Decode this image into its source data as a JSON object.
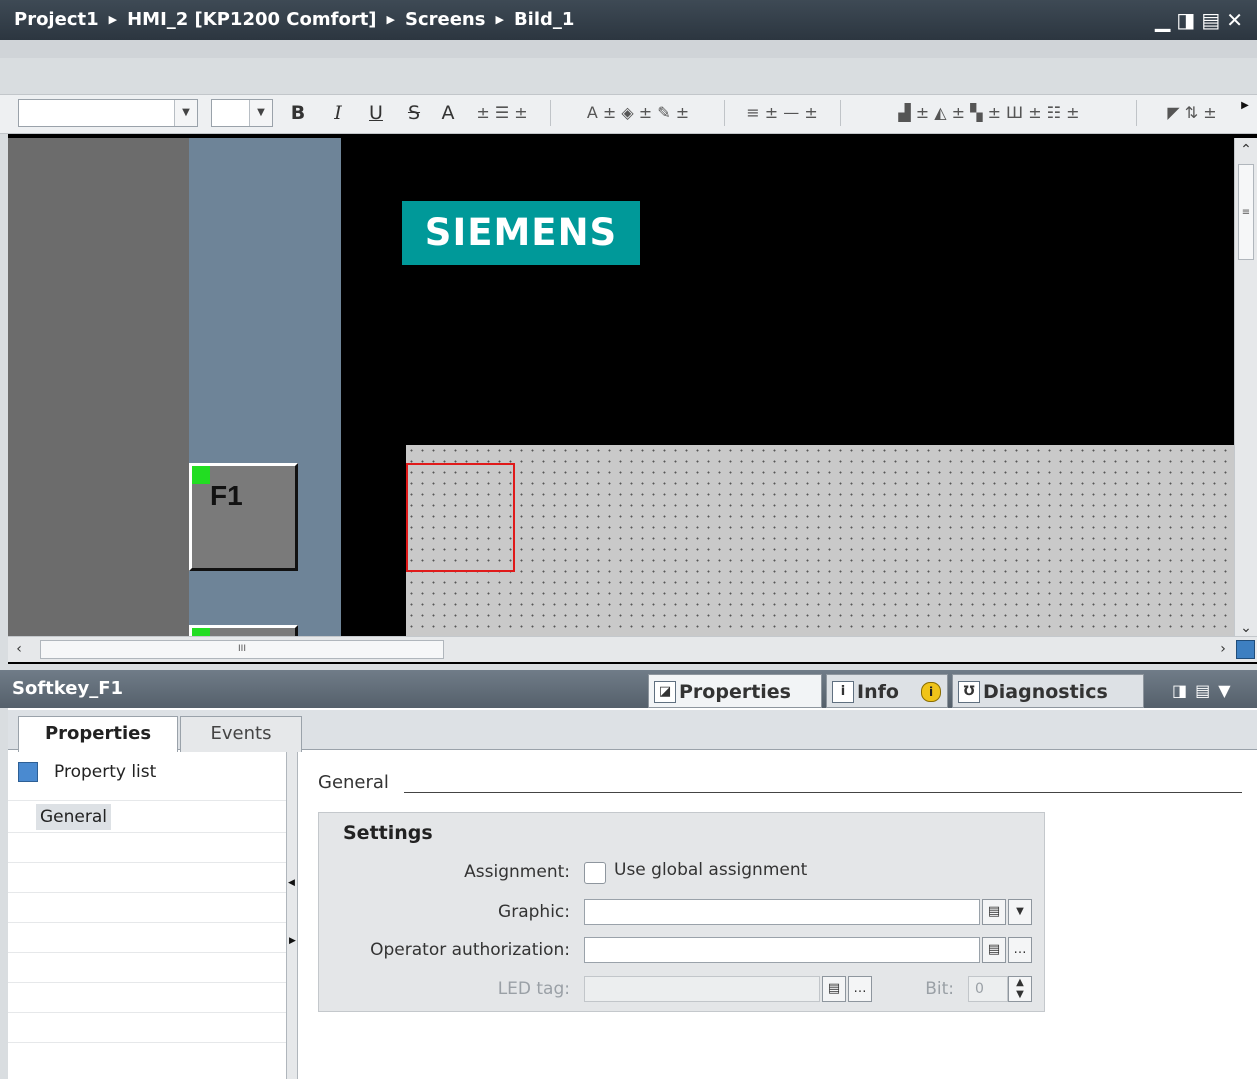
{
  "titlebar": {
    "crumbs": [
      "Project1",
      "HMI_2 [KP1200 Comfort]",
      "Screens",
      "Bild_1"
    ],
    "controls": "_ ▪ ≡ ✕"
  },
  "toolbar": {
    "bold": "B",
    "italic": "I",
    "underline": "U",
    "strike": "S",
    "font_size_up": "A"
  },
  "editor": {
    "logo_text": "SIEMENS",
    "fkey1_label": "F1",
    "hscroll_grip": "III"
  },
  "inspector": {
    "object_name": "Softkey_F1",
    "tabs": [
      {
        "label": "Properties",
        "active": true
      },
      {
        "label": "Info",
        "active": false
      },
      {
        "label": "Diagnostics",
        "active": false
      }
    ],
    "subtabs": [
      "Properties",
      "Events"
    ],
    "nav": {
      "property_list_label": "Property list",
      "items": [
        "General"
      ]
    },
    "section_title": "General",
    "group_title": "Settings",
    "fields": {
      "assignment_label": "Assignment:",
      "assignment_checkbox_label": "Use global assignment",
      "graphic_label": "Graphic:",
      "graphic_value": "",
      "operator_auth_label": "Operator authorization:",
      "operator_auth_value": "",
      "led_tag_label": "LED tag:",
      "led_tag_value": "",
      "bit_label": "Bit:",
      "bit_value": "0"
    }
  }
}
